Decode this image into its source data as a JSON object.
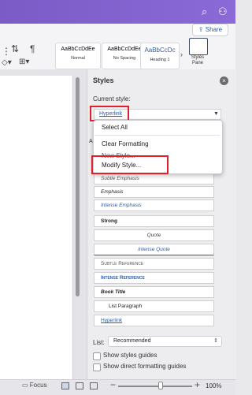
{
  "ribbon": {
    "styles": [
      {
        "preview": "AaBbCcDdEe",
        "name": "Normal"
      },
      {
        "preview": "AaBbCcDdEe",
        "name": "No Spacing"
      },
      {
        "preview": "AaBbCcDc",
        "name": "Heading 1"
      }
    ],
    "share_label": "Share",
    "styles_pane_label_1": "Styles",
    "styles_pane_label_2": "Pane"
  },
  "pane": {
    "title": "Styles",
    "current_style_label": "Current style:",
    "current_style_value": "Hyperlink",
    "dropdown_items": [
      "Select All",
      "Clear Formatting",
      "New Style...",
      "Modify Style..."
    ],
    "list_letter": "A",
    "style_rows": [
      {
        "name": "Subtle Emphasis"
      },
      {
        "name": "Emphasis"
      },
      {
        "name": "Intense Emphasis"
      },
      {
        "name": "Strong"
      },
      {
        "name": "Quote"
      },
      {
        "name": "Intense Quote"
      },
      {
        "name": "Subtle Reference"
      },
      {
        "name": "Intense Reference"
      },
      {
        "name": "Book Title"
      },
      {
        "name": "List Paragraph"
      },
      {
        "name": "Hyperlink"
      }
    ],
    "list_label": "List:",
    "list_value": "Recommended",
    "show_guides": "Show styles guides",
    "show_direct": "Show direct formatting guides"
  },
  "statusbar": {
    "focus_label": "Focus",
    "zoom_percent": "100%",
    "zoom_minus": "−",
    "zoom_plus": "+"
  },
  "icons": [
    "search-icon",
    "share-person-icon",
    "pilcrow-icon",
    "sort-icon",
    "styles-pane-icon",
    "close-icon",
    "focus-icon"
  ],
  "colors": {
    "accent": "#7b5cc7",
    "link": "#1f5fb5",
    "highlight": "#e0202b"
  }
}
